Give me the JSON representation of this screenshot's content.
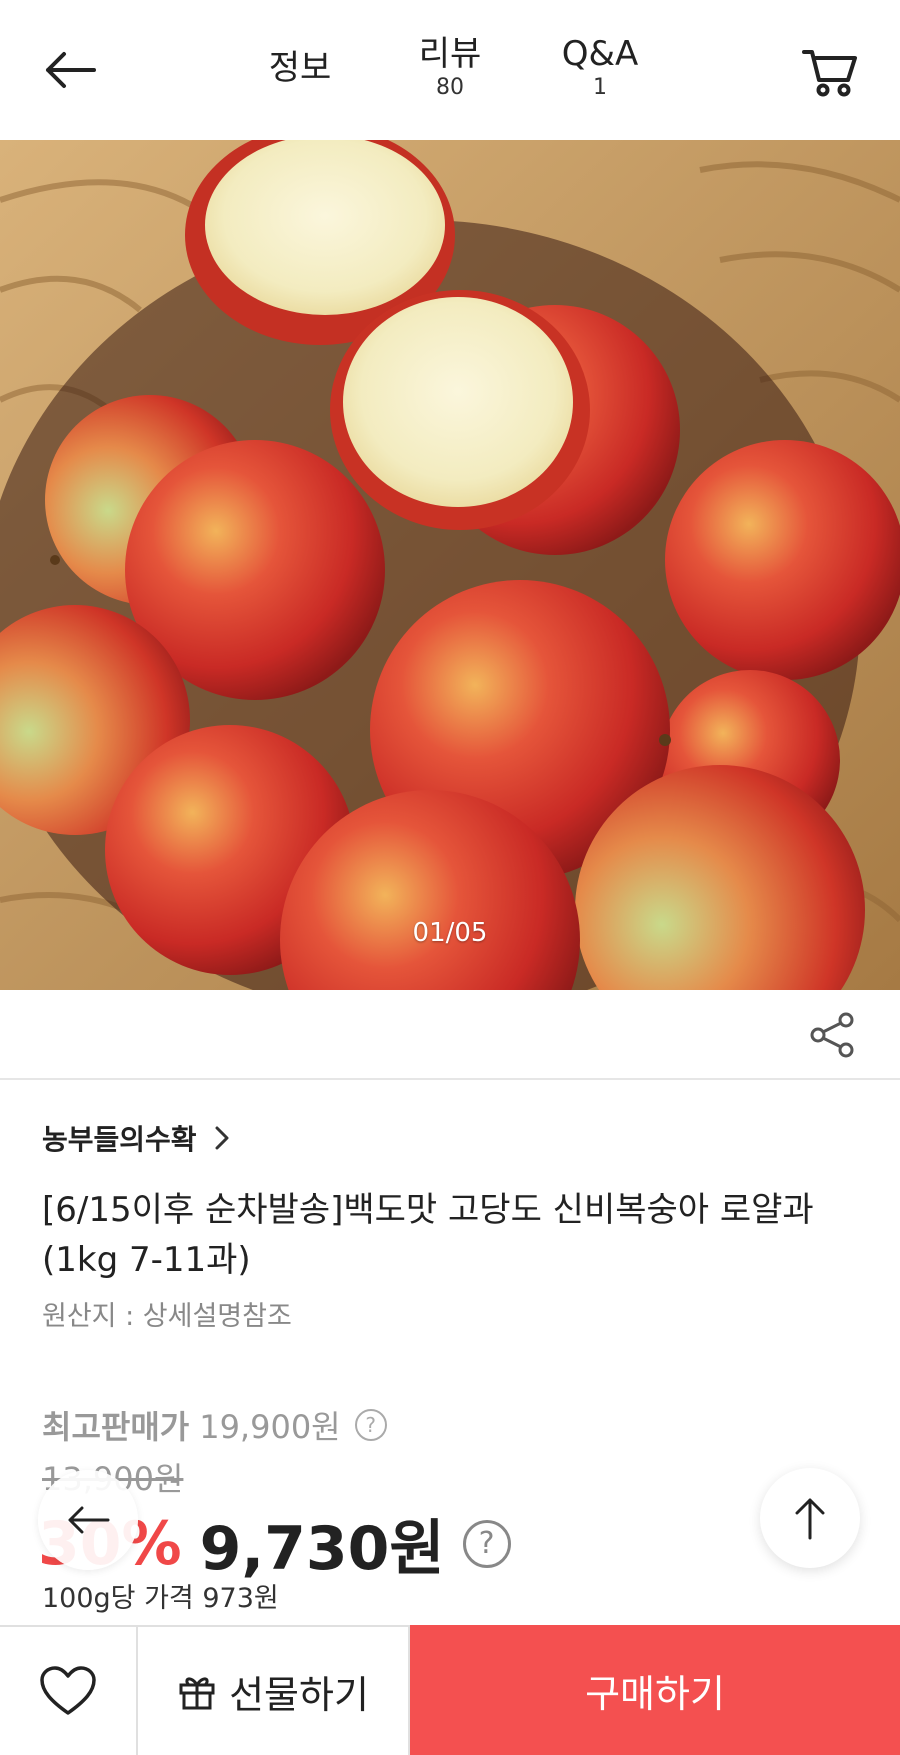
{
  "header": {
    "tabs": [
      {
        "label": "정보",
        "count": ""
      },
      {
        "label": "리뷰",
        "count": "80"
      },
      {
        "label": "Q&A",
        "count": "1"
      }
    ]
  },
  "gallery": {
    "indicator": "01/05"
  },
  "product": {
    "seller": "농부들의수확",
    "title": "[6/15이후 순차발송]백도맛 고당도 신비복숭아 로얄과 (1kg 7-11과)",
    "origin": "원산지 : 상세설명참조",
    "max_price_label": "최고판매가",
    "max_price": "19,900원",
    "original_price": "13,900원",
    "discount": "30%",
    "price": "9,730원",
    "unit_price": "100g당 가격 973원",
    "help_glyph": "?"
  },
  "bottom_bar": {
    "gift_label": "선물하기",
    "buy_label": "구매하기"
  },
  "colors": {
    "accent": "#f45050",
    "discount": "#f04848"
  },
  "icons": [
    "back-arrow-icon",
    "cart-icon",
    "share-icon",
    "chevron-right-icon",
    "help-icon",
    "arrow-up-icon",
    "heart-icon",
    "gift-icon"
  ]
}
